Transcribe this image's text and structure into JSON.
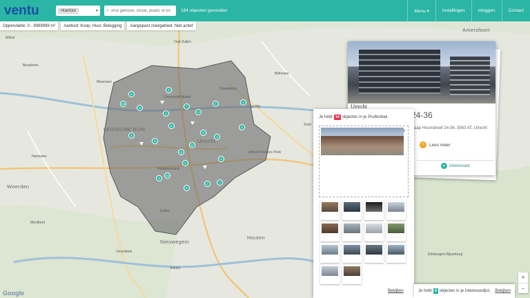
{
  "header": {
    "logo": "ventu",
    "tag_value": "×kantoor",
    "search_placeholder": "vind gebouw, straat, plaats of po",
    "result_count": "184 objecten gevonden",
    "nav": [
      {
        "label": "Menu ▾"
      },
      {
        "label": "Instellingen"
      },
      {
        "label": "Inloggen"
      },
      {
        "label": "Contact"
      }
    ]
  },
  "filters": [
    {
      "label": "Oppervlakte: 0 - 9999999 m²"
    },
    {
      "label": "Aanbod: Koop, Huur, Belegging"
    },
    {
      "label": "Aangepast zoekgebied: Niet actief"
    }
  ],
  "map": {
    "labels": [
      {
        "text": "Wilnis"
      },
      {
        "text": "Breukelen"
      },
      {
        "text": "Maarssen"
      },
      {
        "text": "LEIDSCHE RIJN"
      },
      {
        "text": "Utrecht"
      },
      {
        "text": "Kanaleneiland"
      },
      {
        "text": "Zuilen"
      },
      {
        "text": "Overvecht-Noord"
      },
      {
        "text": "De Bilt"
      },
      {
        "text": "Zeist"
      },
      {
        "text": "Bilthoven"
      },
      {
        "text": "Nieuwegein"
      },
      {
        "text": "Houten"
      },
      {
        "text": "Vianen"
      },
      {
        "text": "IJsselstein"
      },
      {
        "text": "Montfoort"
      },
      {
        "text": "Woerden"
      },
      {
        "text": "Harmelen"
      },
      {
        "text": "Amersfoort"
      },
      {
        "text": "Driebergen-Rijsenburg"
      },
      {
        "text": "Utrecht Science Park"
      },
      {
        "text": "Groenekan"
      },
      {
        "text": "Oud-Zuilen"
      }
    ],
    "clusters": [
      {
        "count": "6"
      },
      {
        "count": "10"
      },
      {
        "count": "6"
      },
      {
        "count": "5"
      },
      {
        "count": "4"
      },
      {
        "count": "7"
      },
      {
        "count": "5"
      },
      {
        "count": "3"
      },
      {
        "count": "2"
      },
      {
        "count": "6"
      },
      {
        "count": "11"
      },
      {
        "count": "9"
      },
      {
        "count": "4"
      },
      {
        "count": "3"
      },
      {
        "count": "18"
      },
      {
        "count": "5"
      },
      {
        "count": "6"
      },
      {
        "count": "2"
      },
      {
        "count": "7"
      },
      {
        "count": "6"
      },
      {
        "count": "8"
      },
      {
        "count": "9"
      },
      {
        "count": "3"
      },
      {
        "count": "4"
      }
    ],
    "zoom_in": "+",
    "zoom_out": "−",
    "attribution": "Google"
  },
  "property_card": {
    "city": "Utrecht",
    "title": "24-36",
    "address": "Kaap Hoorndreef 24-36, 3563 AT, Utrecht",
    "read_more": "Lees meer",
    "interest": "Interessant"
  },
  "trash_panel": {
    "prefix": "Je hebt",
    "count": "14",
    "suffix": "objecten in je",
    "bin_name": "Prullenbak.",
    "view_link": "Bekijken",
    "thumbnail_count": 14
  },
  "interest_bar": {
    "prefix": "Je hebt",
    "count": "4",
    "suffix": "objecten in je Interessedijst.",
    "view_link": "Bekijken"
  },
  "colors": {
    "brand_teal": "#2ab5a4",
    "logo_blue": "#1a4ea3",
    "badge_red": "#e0344b",
    "accent_orange": "#f5a623"
  }
}
